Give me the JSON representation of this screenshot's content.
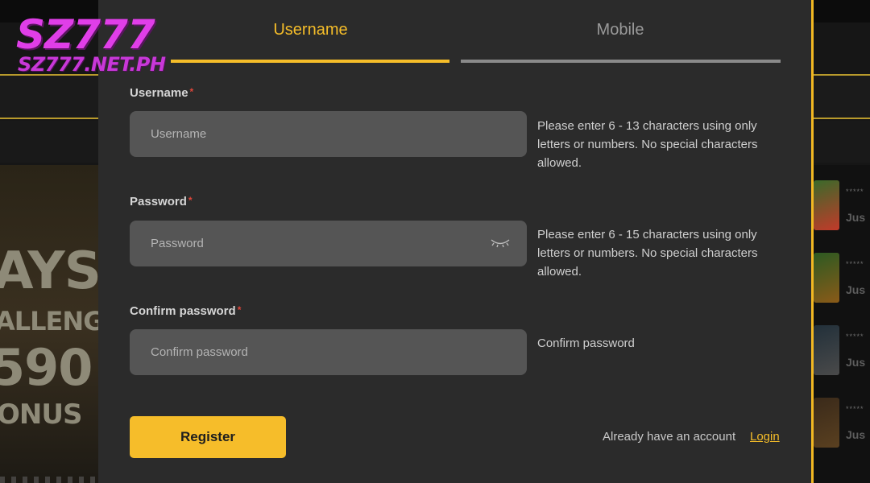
{
  "brand": {
    "logo_text": "SZ777",
    "logo_subtext": "SZ777.NET.PH",
    "accent_color": "#f5bd29",
    "logo_color": "#e03ee8"
  },
  "background": {
    "banner_lines": [
      "AYS",
      "ALLENGE",
      "590",
      "ONUS"
    ],
    "side_list": [
      {
        "stars": "*****",
        "text": "Jus"
      },
      {
        "stars": "*****",
        "text": "Jus"
      },
      {
        "stars": "*****",
        "text": "Jus"
      },
      {
        "stars": "*****",
        "text": "Jus"
      }
    ]
  },
  "tabs": [
    {
      "label": "Username",
      "active": true
    },
    {
      "label": "Mobile",
      "active": false
    }
  ],
  "form": {
    "username": {
      "label": "Username",
      "required_mark": "*",
      "placeholder": "Username",
      "value": "",
      "hint": "Please enter 6 - 13 characters using only letters or numbers. No special characters allowed."
    },
    "password": {
      "label": "Password",
      "required_mark": "*",
      "placeholder": "Password",
      "value": "",
      "visibility_icon": "eye-closed-icon",
      "hint": "Please enter 6 - 15 characters using only letters or numbers. No special characters allowed."
    },
    "confirm_password": {
      "label": "Confirm password",
      "required_mark": "*",
      "placeholder": "Confirm password",
      "value": "",
      "hint": "Confirm password"
    }
  },
  "actions": {
    "register_label": "Register",
    "already_text": "Already have an account",
    "login_label": "Login"
  }
}
